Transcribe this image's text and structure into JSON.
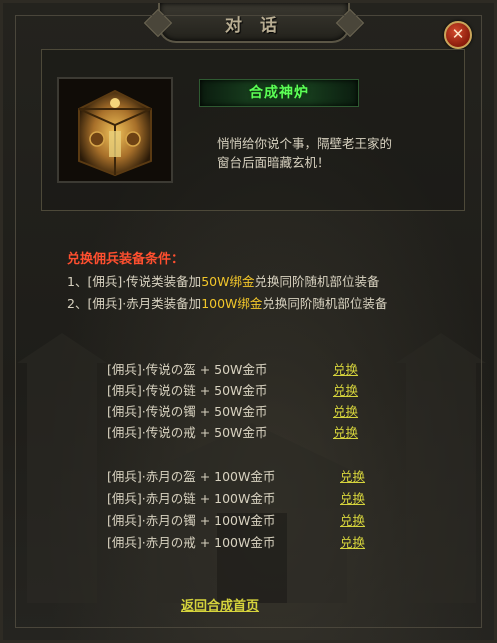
{
  "dialog": {
    "title": "对 话",
    "close_glyph": "✕",
    "npc_name": "合成神炉",
    "npc_text_line1": "悄悄给你说个事，隔壁老王家的",
    "npc_text_line2": "窗台后面暗藏玄机！"
  },
  "conditions": {
    "title": "兑换佣兵装备条件：",
    "lines": [
      {
        "prefix": "1、[佣兵]·传说类装备加",
        "highlight": "50W绑金",
        "suffix": "兑换同阶随机部位装备"
      },
      {
        "prefix": "2、[佣兵]·赤月类装备加",
        "highlight": "100W绑金",
        "suffix": "兑换同阶随机部位装备"
      }
    ]
  },
  "exchange_list": [
    {
      "label": "[佣兵]·传说の盔 + 50W金币",
      "action": "兑换"
    },
    {
      "label": "[佣兵]·传说の链 + 50W金币",
      "action": "兑换"
    },
    {
      "label": "[佣兵]·传说の镯 + 50W金币",
      "action": "兑换"
    },
    {
      "label": "[佣兵]·传说の戒 + 50W金币",
      "action": "兑换"
    },
    {
      "label": "[佣兵]·赤月の盔 + 100W金币",
      "action": "兑换"
    },
    {
      "label": "[佣兵]·赤月の链 + 100W金币",
      "action": "兑换"
    },
    {
      "label": "[佣兵]·赤月の镯 + 100W金币",
      "action": "兑换"
    },
    {
      "label": "[佣兵]·赤月の戒 + 100W金币",
      "action": "兑换"
    }
  ],
  "back_link": "返回合成首页",
  "colors": {
    "npc_name": "#5cff56",
    "condition_title": "#ff4f2f",
    "highlight": "#f2c62a",
    "link": "#d6d43c",
    "text": "#d8d2c0"
  },
  "icons": {
    "portrait": "golden-furnace-icon",
    "close": "close-icon"
  }
}
